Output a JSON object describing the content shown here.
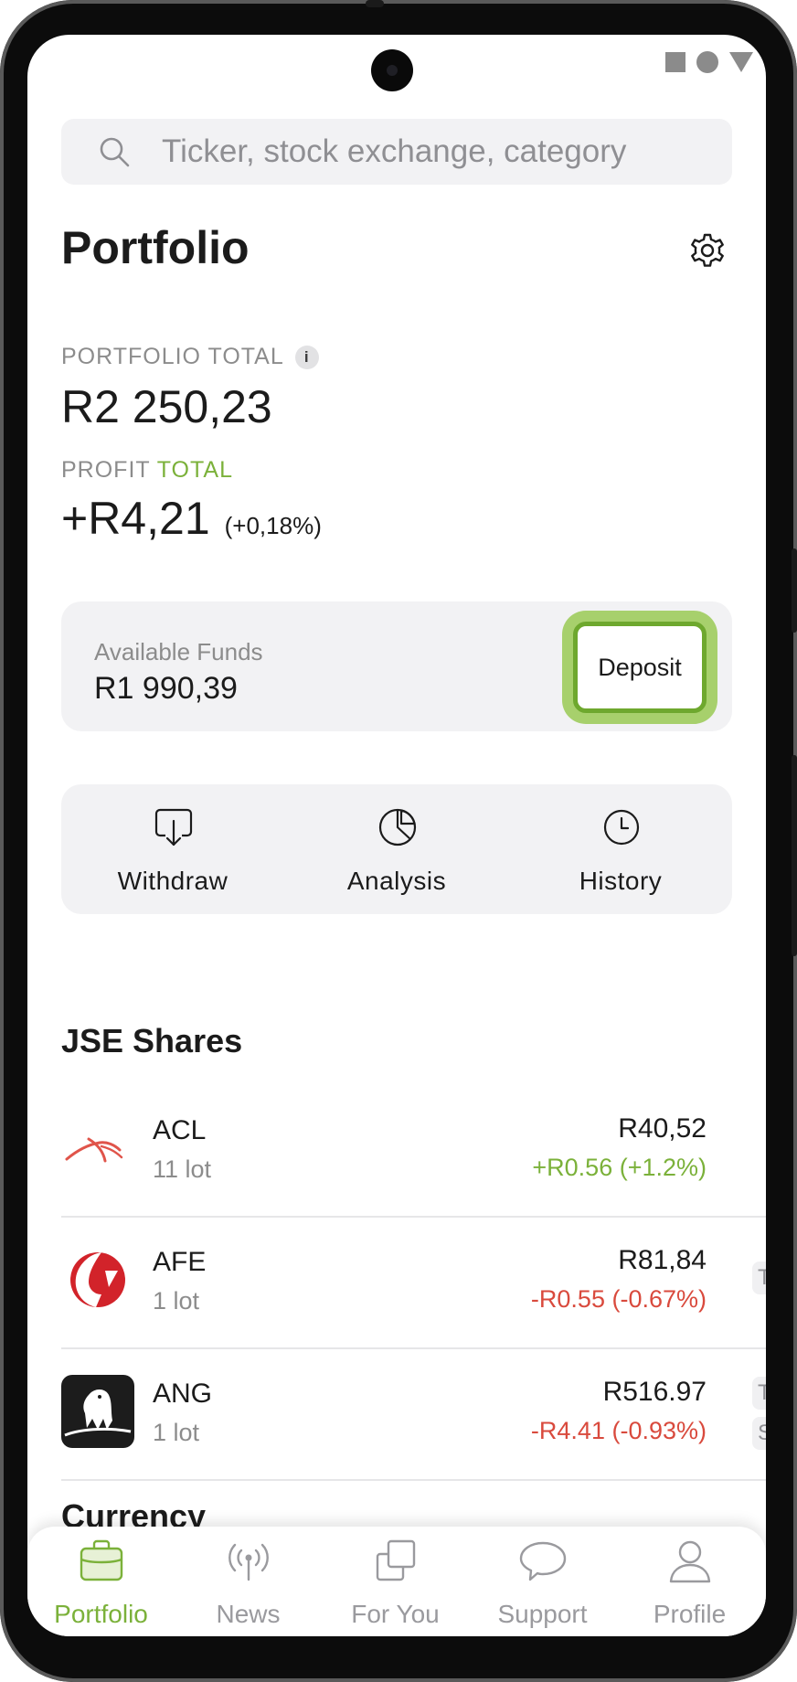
{
  "search": {
    "placeholder": "Ticker, stock exchange, category"
  },
  "header": {
    "title": "Portfolio"
  },
  "summary": {
    "total_label": "PORTFOLIO TOTAL",
    "info_icon": "i",
    "total_value": "R2 250,23",
    "profit_label": "PROFIT",
    "profit_period": "TOTAL",
    "profit_value": "+R4,21",
    "profit_pct": "(+0,18%)"
  },
  "funds": {
    "label": "Available Funds",
    "value": "R1 990,39",
    "deposit_label": "Deposit"
  },
  "actions": [
    {
      "label": "Withdraw",
      "icon": "withdraw-icon"
    },
    {
      "label": "Analysis",
      "icon": "pie-chart-icon"
    },
    {
      "label": "History",
      "icon": "clock-icon"
    }
  ],
  "jse": {
    "title": "JSE Shares",
    "items": [
      {
        "ticker": "ACL",
        "lots": "11 lot",
        "price": "R40,52",
        "change": "+R0.56 (+1.2%)",
        "direction": "up",
        "badges": []
      },
      {
        "ticker": "AFE",
        "lots": "1 lot",
        "price": "R81,84",
        "change": "-R0.55 (-0.67%)",
        "direction": "down",
        "badges": [
          "TP"
        ]
      },
      {
        "ticker": "ANG",
        "lots": "1 lot",
        "price": "R516.97",
        "change": "-R4.41 (-0.93%)",
        "direction": "down",
        "badges": [
          "TP",
          "SL"
        ]
      }
    ]
  },
  "currency": {
    "title": "Currency"
  },
  "nav": [
    {
      "label": "Portfolio",
      "icon": "briefcase-icon",
      "active": true
    },
    {
      "label": "News",
      "icon": "broadcast-icon",
      "active": false
    },
    {
      "label": "For You",
      "icon": "copy-icon",
      "active": false
    },
    {
      "label": "Support",
      "icon": "chat-icon",
      "active": false
    },
    {
      "label": "Profile",
      "icon": "user-icon",
      "active": false
    }
  ],
  "colors": {
    "accent": "#7bb13a",
    "negative": "#d94a3d",
    "card": "#f2f2f4",
    "muted": "#8c8c8c"
  }
}
